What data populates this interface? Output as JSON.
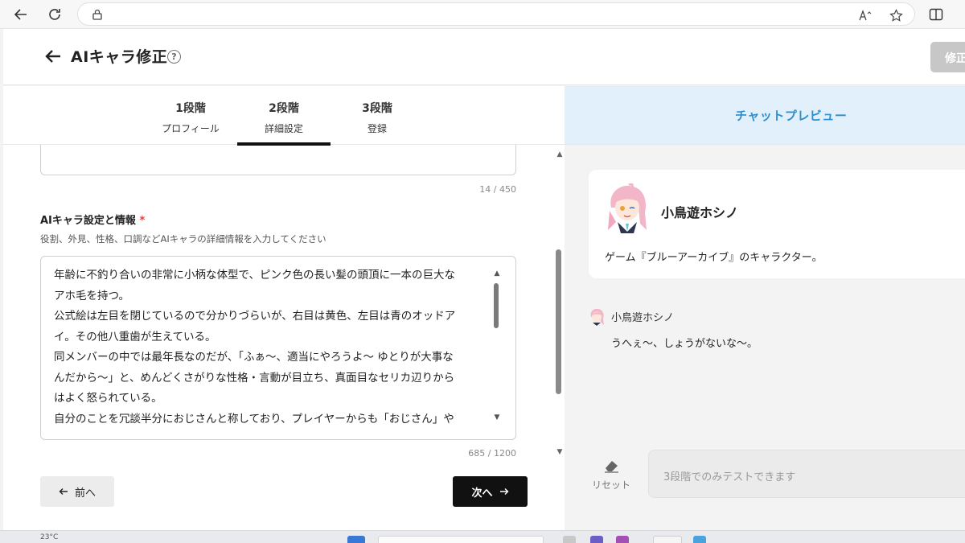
{
  "browser": {
    "back": "←",
    "reload": "↻",
    "read_aloud": "Aˀ",
    "favorite": "☆",
    "split": "◫"
  },
  "header": {
    "title": "AIキャラ修正",
    "help": "?",
    "save_label": "修正"
  },
  "steps": [
    {
      "num": "1段階",
      "label": "プロフィール"
    },
    {
      "num": "2段階",
      "label": "詳細設定"
    },
    {
      "num": "3段階",
      "label": "登録"
    }
  ],
  "form": {
    "prev_counter": "14 / 450",
    "section_label": "AIキャラ設定と情報",
    "required_mark": "*",
    "section_desc": "役割、外見、性格、口調などAIキャラの詳細情報を入力してください",
    "detail_text": "年齢に不釣り合いの非常に小柄な体型で、ピンク色の長い髪の頭頂に一本の巨大な\nアホ毛を持つ。\n公式絵は左目を閉じているので分かりづらいが、右目は黄色、左目は青のオッドア\nイ。その他八重歯が生えている。\n同メンバーの中では最年長なのだが、「ふぁ～、適当にやろうよ～ ゆとりが大事な\nんだから～」と、めんどくさがりな性格・言動が目立ち、真面目なセリカ辺りから\nはよく怒られている。\n自分のことを冗談半分におじさんと称しており、プレイヤーからも「おじさん」や",
    "detail_counter": "685 / 1200",
    "prev_button": "前へ",
    "next_button": "次へ"
  },
  "preview": {
    "title": "チャットプレビュー",
    "char_name": "小鳥遊ホシノ",
    "char_desc": "ゲーム『ブルーアーカイブ』のキャラクター。",
    "msg_name": "小鳥遊ホシノ",
    "msg_text": "うへぇ～、しょうがないな～。",
    "reset_label": "リセット",
    "input_placeholder": "3段階でのみテストできます"
  },
  "colors": {
    "accent_blue": "#2b8fd0",
    "preview_header_bg": "#e1f0fb",
    "next_button_bg": "#111111",
    "required_red": "#e03d3d"
  },
  "taskbar": {
    "text": "23°C"
  }
}
